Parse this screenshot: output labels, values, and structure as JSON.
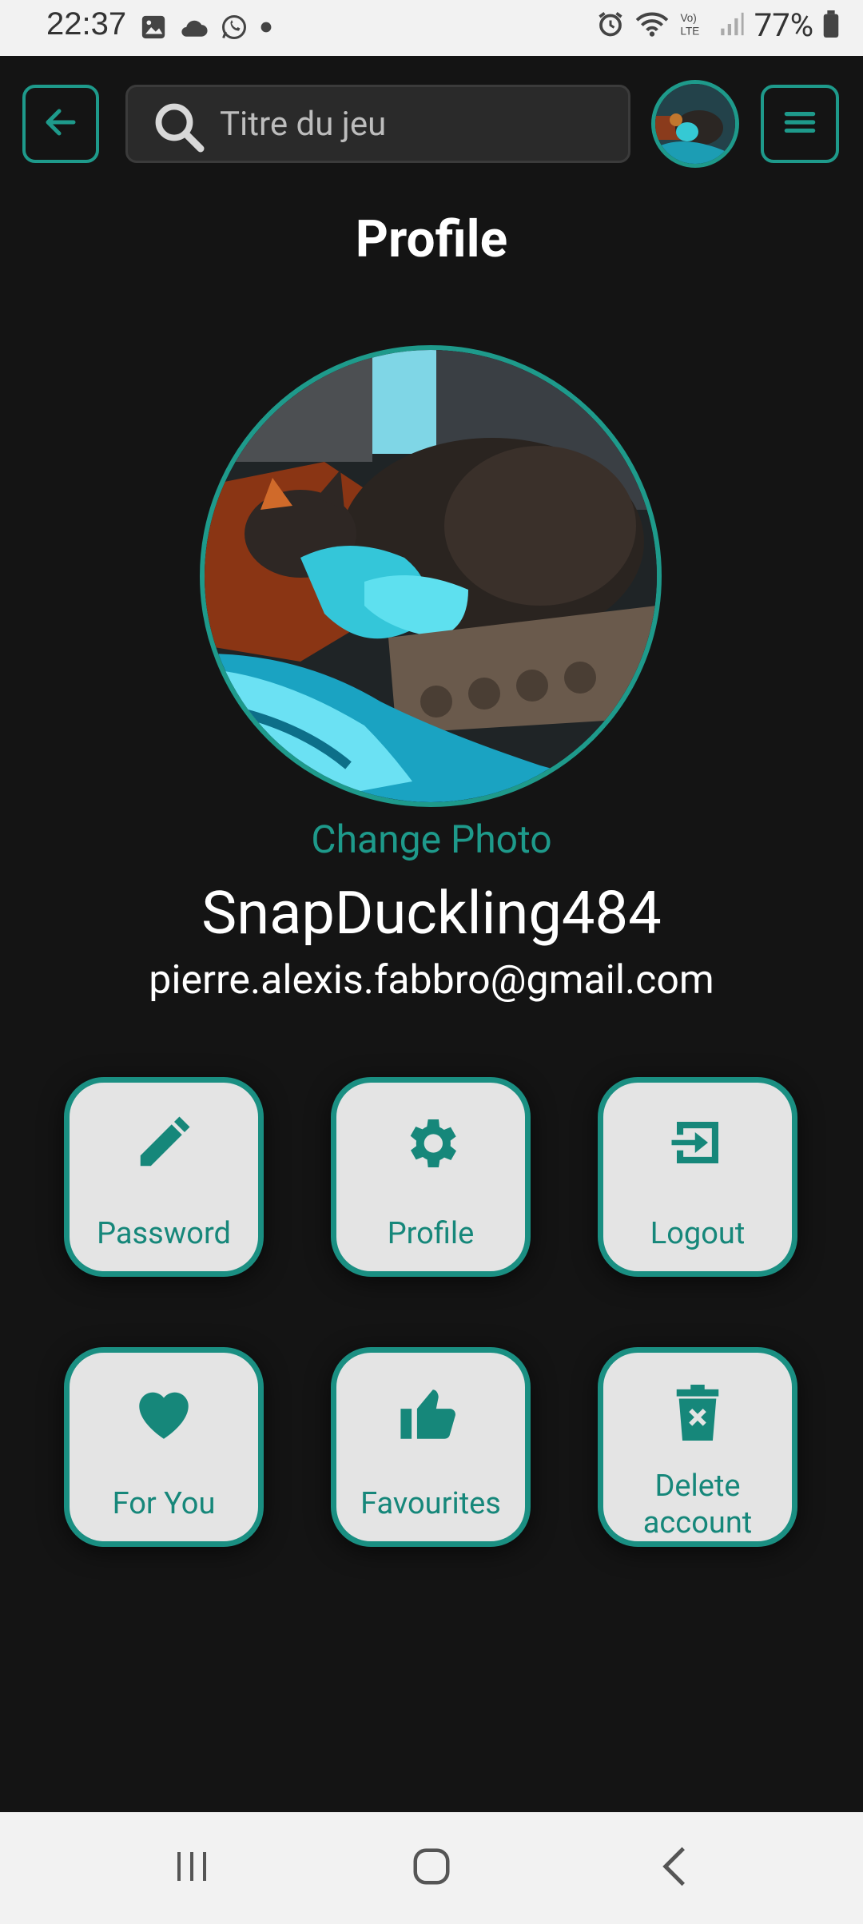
{
  "status_bar": {
    "time": "22:37",
    "battery_percent": "77%",
    "icons": [
      "image-icon",
      "cloud-icon",
      "whatsapp-icon",
      "dot-icon",
      "alarm-icon",
      "wifi-icon",
      "volte-icon",
      "signal-icon",
      "battery-icon"
    ]
  },
  "top_bar": {
    "back_icon": "arrow-left-icon",
    "search_icon": "search-icon",
    "search_placeholder": "Titre du jeu",
    "menu_icon": "hamburger-menu-icon"
  },
  "page": {
    "title": "Profile",
    "change_photo_label": "Change Photo",
    "username": "SnapDuckling484",
    "email": "pierre.alexis.fabbro@gmail.com"
  },
  "actions": [
    {
      "label": "Password",
      "icon": "pencil-icon"
    },
    {
      "label": "Profile",
      "icon": "gear-icon"
    },
    {
      "label": "Logout",
      "icon": "logout-icon"
    },
    {
      "label": "For You",
      "icon": "heart-icon"
    },
    {
      "label": "Favourites",
      "icon": "thumbs-up-icon"
    },
    {
      "label": "Delete",
      "label2": "account",
      "icon": "trash-icon"
    }
  ],
  "colors": {
    "accent": "#1e9a8b",
    "background": "#141414",
    "card": "#e4e4e4"
  },
  "nav_bar": {
    "icons": [
      "recent-apps-icon",
      "home-icon",
      "back-nav-icon"
    ]
  }
}
